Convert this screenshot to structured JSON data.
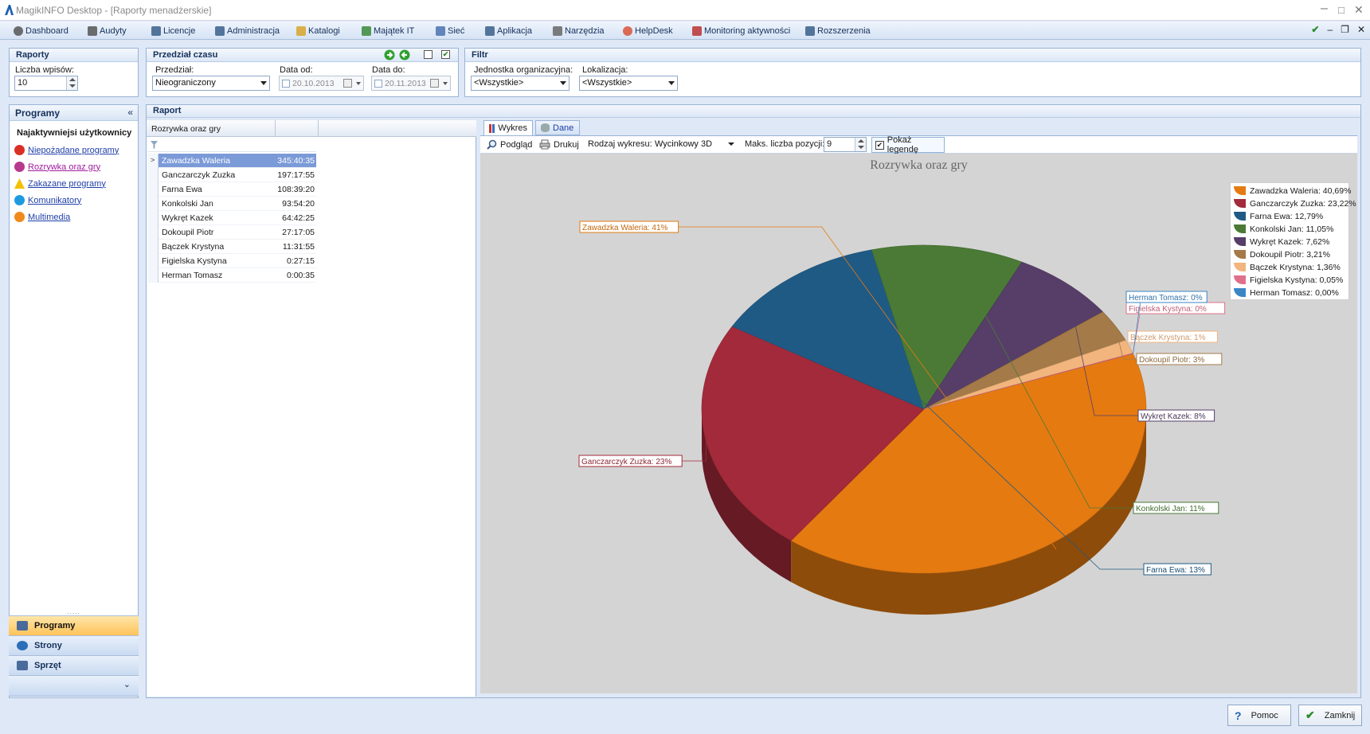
{
  "window": {
    "title": "MagikINFO Desktop - [Raporty menadżerskie]"
  },
  "menu": [
    {
      "label": "Dashboard",
      "icon": "dashboard-icon"
    },
    {
      "label": "Audyty",
      "icon": "audit-icon"
    },
    {
      "label": "Licencje",
      "icon": "license-icon"
    },
    {
      "label": "Administracja",
      "icon": "admin-icon"
    },
    {
      "label": "Katalogi",
      "icon": "folder-icon"
    },
    {
      "label": "Majątek IT",
      "icon": "assets-icon"
    },
    {
      "label": "Sieć",
      "icon": "network-icon"
    },
    {
      "label": "Aplikacja",
      "icon": "application-icon"
    },
    {
      "label": "Narzędzia",
      "icon": "tools-icon"
    },
    {
      "label": "HelpDesk",
      "icon": "helpdesk-icon"
    },
    {
      "label": "Monitoring aktywności",
      "icon": "monitoring-icon"
    },
    {
      "label": "Rozszerzenia",
      "icon": "extensions-icon"
    }
  ],
  "raporty": {
    "title": "Raporty",
    "count_label": "Liczba wpisów:",
    "count_value": "10"
  },
  "przedzial": {
    "title": "Przedział czasu",
    "range_label": "Przedział:",
    "range_value": "Nieograniczony",
    "from_label": "Data od:",
    "from_value": "20.10.2013",
    "to_label": "Data do:",
    "to_value": "20.11.2013"
  },
  "filtr": {
    "title": "Filtr",
    "unit_label": "Jednostka organizacyjna:",
    "unit_value": "<Wszystkie>",
    "location_label": "Lokalizacja:",
    "location_value": "<Wszystkie>"
  },
  "programy": {
    "title": "Programy",
    "collapse": "«",
    "section_title": "Najaktywniejsi użytkownicy",
    "links": [
      {
        "label": "Niepożądane programy",
        "icon": "error-icon",
        "color": "#d93025"
      },
      {
        "label": "Rozrywka oraz gry",
        "icon": "games-icon",
        "color": "#b73a8e"
      },
      {
        "label": "Zakazane programy",
        "icon": "warning-icon",
        "color": "#f2c200"
      },
      {
        "label": "Komunikatory",
        "icon": "skype-icon",
        "color": "#1e9be0"
      },
      {
        "label": "Multimedia",
        "icon": "media-icon",
        "color": "#f08a1c"
      }
    ],
    "nav": [
      {
        "label": "Programy",
        "icon": "programs-icon"
      },
      {
        "label": "Strony",
        "icon": "globe-icon"
      },
      {
        "label": "Sprzęt",
        "icon": "hardware-icon"
      }
    ],
    "splitter": ".....",
    "more": "⌄"
  },
  "raport": {
    "title": "Raport",
    "grid_header": "Rozrywka oraz gry",
    "row_indicator": ">",
    "rows": [
      {
        "name": "Zawadzka Waleria",
        "time": "345:40:35"
      },
      {
        "name": "Ganczarczyk Zuzka",
        "time": "197:17:55"
      },
      {
        "name": "Farna Ewa",
        "time": "108:39:20"
      },
      {
        "name": "Konkolski Jan",
        "time": "93:54:20"
      },
      {
        "name": "Wykręt Kazek",
        "time": "64:42:25"
      },
      {
        "name": "Dokoupil Piotr",
        "time": "27:17:05"
      },
      {
        "name": "Bączek Krystyna",
        "time": "11:31:55"
      },
      {
        "name": "Figielska Kystyna",
        "time": "0:27:15"
      },
      {
        "name": "Herman Tomasz",
        "time": "0:00:35"
      }
    ]
  },
  "tabs": [
    {
      "label": "Wykres"
    },
    {
      "label": "Dane"
    }
  ],
  "toolbar": {
    "preview": "Podgląd",
    "print": "Drukuj",
    "chart_type_label": "Rodzaj wykresu:",
    "chart_type_value": "Wycinkowy 3D",
    "max_label": "Maks. liczba pozycji:",
    "max_value": "9",
    "legend_label": "Pokaż legendę"
  },
  "chart_data": {
    "type": "pie",
    "title": "Rozrywka oraz gry",
    "categories": [
      "Zawadzka Waleria",
      "Ganczarczyk Zuzka",
      "Farna Ewa",
      "Konkolski Jan",
      "Wykręt Kazek",
      "Dokoupil Piotr",
      "Bączek Krystyna",
      "Figielska Kystyna",
      "Herman Tomasz"
    ],
    "values": [
      40.69,
      23.22,
      12.79,
      11.05,
      7.62,
      3.21,
      1.36,
      0.05,
      0.0
    ],
    "colors": [
      "#e57a10",
      "#a32a3a",
      "#1f5a85",
      "#4a7a35",
      "#563e68",
      "#a37a48",
      "#f2b57e",
      "#e0708a",
      "#3a86c5"
    ],
    "legend_entries": [
      "Zawadzka Waleria: 40,69%",
      "Ganczarczyk Zuzka: 23,22%",
      "Farna Ewa: 12,79%",
      "Konkolski Jan: 11,05%",
      "Wykręt Kazek: 7,62%",
      "Dokoupil Piotr: 3,21%",
      "Bączek Krystyna: 1,36%",
      "Figielska Kystyna: 0,05%",
      "Herman Tomasz: 0,00%"
    ],
    "data_labels": [
      "Zawadzka Waleria: 41%",
      "Ganczarczyk Zuzka: 23%",
      "Farna Ewa: 13%",
      "Konkolski Jan: 11%",
      "Wykręt Kazek: 8%",
      "Dokoupil Piotr: 3%",
      "Bączek Krystyna: 1%",
      "Figielska Kystyna: 0%",
      "Herman Tomasz: 0%"
    ],
    "legend_position": "top-right",
    "style": "3d-pie"
  },
  "footer": {
    "help": "Pomoc",
    "close": "Zamknij"
  }
}
